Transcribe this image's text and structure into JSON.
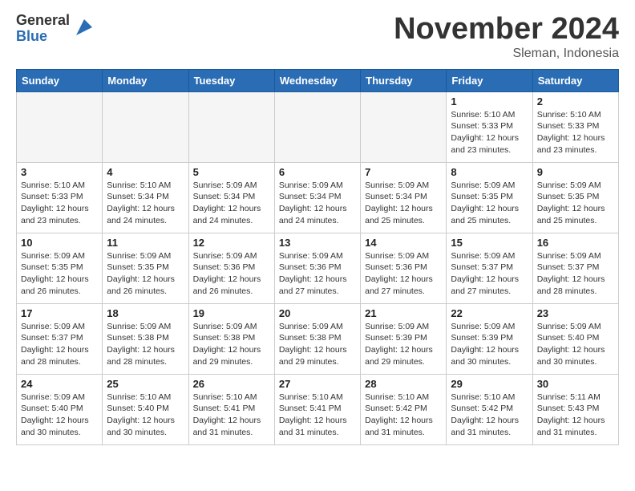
{
  "header": {
    "logo_general": "General",
    "logo_blue": "Blue",
    "month_title": "November 2024",
    "location": "Sleman, Indonesia"
  },
  "days_of_week": [
    "Sunday",
    "Monday",
    "Tuesday",
    "Wednesday",
    "Thursday",
    "Friday",
    "Saturday"
  ],
  "weeks": [
    [
      {
        "day": "",
        "info": ""
      },
      {
        "day": "",
        "info": ""
      },
      {
        "day": "",
        "info": ""
      },
      {
        "day": "",
        "info": ""
      },
      {
        "day": "",
        "info": ""
      },
      {
        "day": "1",
        "info": "Sunrise: 5:10 AM\nSunset: 5:33 PM\nDaylight: 12 hours\nand 23 minutes."
      },
      {
        "day": "2",
        "info": "Sunrise: 5:10 AM\nSunset: 5:33 PM\nDaylight: 12 hours\nand 23 minutes."
      }
    ],
    [
      {
        "day": "3",
        "info": "Sunrise: 5:10 AM\nSunset: 5:33 PM\nDaylight: 12 hours\nand 23 minutes."
      },
      {
        "day": "4",
        "info": "Sunrise: 5:10 AM\nSunset: 5:34 PM\nDaylight: 12 hours\nand 24 minutes."
      },
      {
        "day": "5",
        "info": "Sunrise: 5:09 AM\nSunset: 5:34 PM\nDaylight: 12 hours\nand 24 minutes."
      },
      {
        "day": "6",
        "info": "Sunrise: 5:09 AM\nSunset: 5:34 PM\nDaylight: 12 hours\nand 24 minutes."
      },
      {
        "day": "7",
        "info": "Sunrise: 5:09 AM\nSunset: 5:34 PM\nDaylight: 12 hours\nand 25 minutes."
      },
      {
        "day": "8",
        "info": "Sunrise: 5:09 AM\nSunset: 5:35 PM\nDaylight: 12 hours\nand 25 minutes."
      },
      {
        "day": "9",
        "info": "Sunrise: 5:09 AM\nSunset: 5:35 PM\nDaylight: 12 hours\nand 25 minutes."
      }
    ],
    [
      {
        "day": "10",
        "info": "Sunrise: 5:09 AM\nSunset: 5:35 PM\nDaylight: 12 hours\nand 26 minutes."
      },
      {
        "day": "11",
        "info": "Sunrise: 5:09 AM\nSunset: 5:35 PM\nDaylight: 12 hours\nand 26 minutes."
      },
      {
        "day": "12",
        "info": "Sunrise: 5:09 AM\nSunset: 5:36 PM\nDaylight: 12 hours\nand 26 minutes."
      },
      {
        "day": "13",
        "info": "Sunrise: 5:09 AM\nSunset: 5:36 PM\nDaylight: 12 hours\nand 27 minutes."
      },
      {
        "day": "14",
        "info": "Sunrise: 5:09 AM\nSunset: 5:36 PM\nDaylight: 12 hours\nand 27 minutes."
      },
      {
        "day": "15",
        "info": "Sunrise: 5:09 AM\nSunset: 5:37 PM\nDaylight: 12 hours\nand 27 minutes."
      },
      {
        "day": "16",
        "info": "Sunrise: 5:09 AM\nSunset: 5:37 PM\nDaylight: 12 hours\nand 28 minutes."
      }
    ],
    [
      {
        "day": "17",
        "info": "Sunrise: 5:09 AM\nSunset: 5:37 PM\nDaylight: 12 hours\nand 28 minutes."
      },
      {
        "day": "18",
        "info": "Sunrise: 5:09 AM\nSunset: 5:38 PM\nDaylight: 12 hours\nand 28 minutes."
      },
      {
        "day": "19",
        "info": "Sunrise: 5:09 AM\nSunset: 5:38 PM\nDaylight: 12 hours\nand 29 minutes."
      },
      {
        "day": "20",
        "info": "Sunrise: 5:09 AM\nSunset: 5:38 PM\nDaylight: 12 hours\nand 29 minutes."
      },
      {
        "day": "21",
        "info": "Sunrise: 5:09 AM\nSunset: 5:39 PM\nDaylight: 12 hours\nand 29 minutes."
      },
      {
        "day": "22",
        "info": "Sunrise: 5:09 AM\nSunset: 5:39 PM\nDaylight: 12 hours\nand 30 minutes."
      },
      {
        "day": "23",
        "info": "Sunrise: 5:09 AM\nSunset: 5:40 PM\nDaylight: 12 hours\nand 30 minutes."
      }
    ],
    [
      {
        "day": "24",
        "info": "Sunrise: 5:09 AM\nSunset: 5:40 PM\nDaylight: 12 hours\nand 30 minutes."
      },
      {
        "day": "25",
        "info": "Sunrise: 5:10 AM\nSunset: 5:40 PM\nDaylight: 12 hours\nand 30 minutes."
      },
      {
        "day": "26",
        "info": "Sunrise: 5:10 AM\nSunset: 5:41 PM\nDaylight: 12 hours\nand 31 minutes."
      },
      {
        "day": "27",
        "info": "Sunrise: 5:10 AM\nSunset: 5:41 PM\nDaylight: 12 hours\nand 31 minutes."
      },
      {
        "day": "28",
        "info": "Sunrise: 5:10 AM\nSunset: 5:42 PM\nDaylight: 12 hours\nand 31 minutes."
      },
      {
        "day": "29",
        "info": "Sunrise: 5:10 AM\nSunset: 5:42 PM\nDaylight: 12 hours\nand 31 minutes."
      },
      {
        "day": "30",
        "info": "Sunrise: 5:11 AM\nSunset: 5:43 PM\nDaylight: 12 hours\nand 31 minutes."
      }
    ]
  ]
}
